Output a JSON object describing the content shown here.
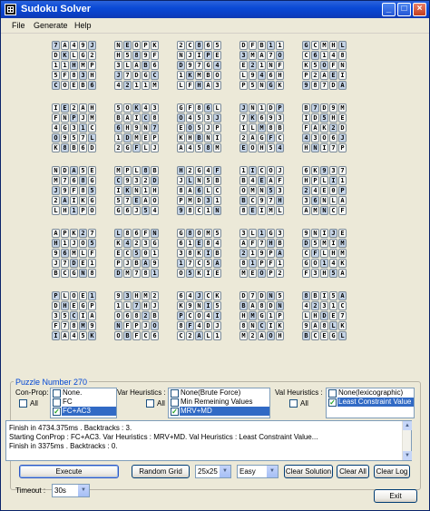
{
  "window": {
    "title": "Sudoku Solver"
  },
  "menu": [
    "File",
    "Generate",
    "Help"
  ],
  "board_rows": [
    "7A49J NEOPK 2C865 DFB11 GCMHL",
    "DKLG2 H589F NJIPE 3MA7O C6148",
    "11HMP 3LAB6 D97G4 E21NF K5OFN",
    "5F83H J7DGC 1KMBO L946H P2AEI",
    "COEB6 4211M LFHA3 P5NGK 987DA",
    "IE2AH 5OK43 GF86L JN1DP B7D9M",
    "FNPJM BAIC8 O453J 7K693 ID5HE",
    "4G31C 6H9N7 EO5JP ILM8B FAK2D",
    "O957L 1DMEP KHBNI 2AGFC 43O6J",
    "K8B6D 2GFLJ A458M EOH54 HNI7P",
    "NDA5E MPL8B H2G4F 1ICOJ 6K937",
    "M768G C932D JLN5B B4EAF HPLI1",
    "J9F85 IKN1H 8A6LC OMN53 24E0P",
    "2AIKG 57EAO PMD31 BC97H 36NLA",
    "LH1PO G6J54 98C1N 8EIML AMNCF",
    "APK27 L86FN G8OM5 3L1G3 9NIJE",
    "H1JO5 K423G 61E84 AF7HB D5MIM",
    "96MLF EC501 38KIB 219PA CFLHM",
    "J7DE1 PJBA9 17C5A 81PF1 GO14K",
    "BCGN8 DM781 O5KIE MEOP2 F3H5A",
    "PLOE1 93HM2 64JCK D7DN5 8BI5A",
    "DHEGP 1L7HJ K9NI5 BA8DN 4231C",
    "35CIA O682B PCO4I HMG1P LHDE7",
    "F78M9 NFPJO 8F4DJ 8NCIK 9A8LK",
    "IA45K OBFC6A C2AL1 M2AOH BCEGL"
  ],
  "puzzle": {
    "label": "Puzzle Number 270",
    "conprop": {
      "label": "Con-Prop:",
      "all_label": "All",
      "options": [
        "None.",
        "FC",
        "FC+AC3"
      ],
      "checked_index": 2
    },
    "var_heuristics": {
      "label": "Var Heuristics :",
      "all_label": "All",
      "options": [
        "None(Brute Force)",
        "Min Remeining Values",
        "MRV+MD"
      ],
      "checked_index": 2
    },
    "val_heuristics": {
      "label": "Val Heuristics :",
      "all_label": "All",
      "options": [
        "None(lexicographic)",
        "Least Constraint Value"
      ],
      "checked_index": 1
    }
  },
  "log": {
    "lines": [
      "Finish in 4734.375ms . Backtracks : 3.",
      "Starting ConProp : FC+AC3. Var Heuristics : MRV+MD. Val Heuristics : Least Constraint Value...",
      "Finish in 3375ms . Backtracks : 0."
    ]
  },
  "buttons": {
    "execute": "Execute",
    "random_grid": "Random Grid",
    "clear_solution": "Clear Solution",
    "clear_all": "Clear All",
    "clear_log": "Clear Log",
    "exit": "Exit"
  },
  "size_select": {
    "value": "25x25"
  },
  "difficulty_select": {
    "value": "Easy"
  },
  "timeout": {
    "label": "Timeout :",
    "value": "30s"
  },
  "icons": {
    "app": "sudoku-app-icon",
    "minimize": "minimize-icon",
    "maximize": "maximize-icon",
    "close": "close-icon"
  },
  "colors": {
    "selection": "#316ac5",
    "given_cell": "#c6d4e6",
    "group_label": "#0046d5"
  }
}
